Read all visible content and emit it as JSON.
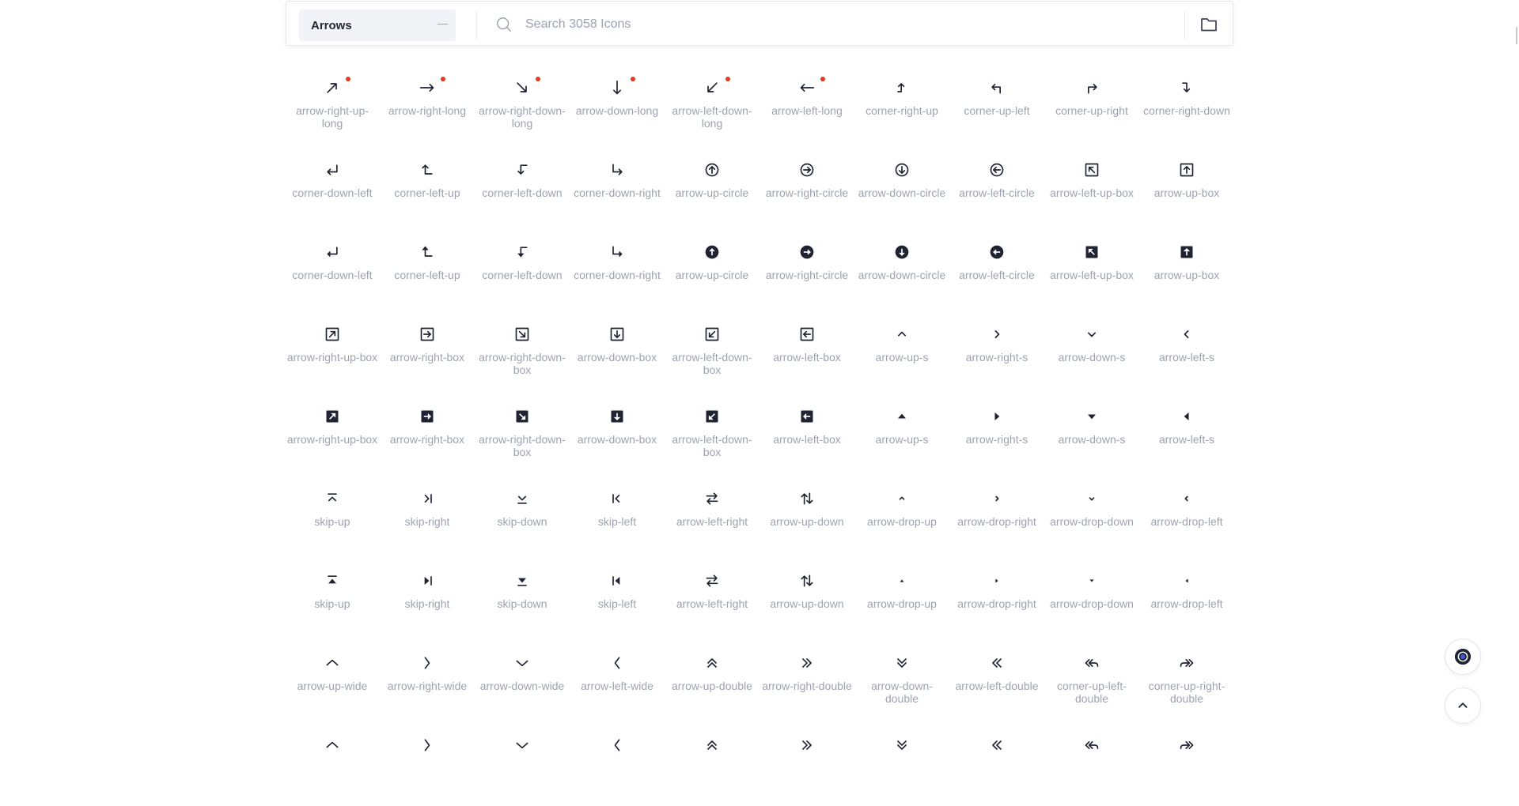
{
  "category_select": {
    "value": "Arrows"
  },
  "search": {
    "placeholder": "Search 3058 Icons"
  },
  "colors": {
    "icon": "#1e2432",
    "label": "#9ca3af",
    "new_dot": "#e03b1f"
  },
  "icons": [
    {
      "label": "arrow-right-up-long",
      "icon": "arrow-right-up-long",
      "new": true
    },
    {
      "label": "arrow-right-long",
      "icon": "arrow-right-long",
      "new": true
    },
    {
      "label": "arrow-right-down-long",
      "icon": "arrow-right-down-long",
      "new": true
    },
    {
      "label": "arrow-down-long",
      "icon": "arrow-down-long",
      "new": true
    },
    {
      "label": "arrow-left-down-long",
      "icon": "arrow-left-down-long",
      "new": true
    },
    {
      "label": "arrow-left-long",
      "icon": "arrow-left-long",
      "new": true
    },
    {
      "label": "corner-right-up",
      "icon": "corner-right-up"
    },
    {
      "label": "corner-up-left",
      "icon": "corner-up-left"
    },
    {
      "label": "corner-up-right",
      "icon": "corner-up-right"
    },
    {
      "label": "corner-right-down",
      "icon": "corner-right-down"
    },
    {
      "label": "corner-down-left",
      "icon": "corner-down-left"
    },
    {
      "label": "corner-left-up",
      "icon": "corner-left-up"
    },
    {
      "label": "corner-left-down",
      "icon": "corner-left-down"
    },
    {
      "label": "corner-down-right",
      "icon": "corner-down-right"
    },
    {
      "label": "arrow-up-circle",
      "icon": "arrow-up-circle"
    },
    {
      "label": "arrow-right-circle",
      "icon": "arrow-right-circle"
    },
    {
      "label": "arrow-down-circle",
      "icon": "arrow-down-circle"
    },
    {
      "label": "arrow-left-circle",
      "icon": "arrow-left-circle"
    },
    {
      "label": "arrow-left-up-box",
      "icon": "arrow-left-up-box"
    },
    {
      "label": "arrow-up-box",
      "icon": "arrow-up-box"
    },
    {
      "label": "corner-down-left",
      "icon": "corner-down-left-solid"
    },
    {
      "label": "corner-left-up",
      "icon": "corner-left-up-solid"
    },
    {
      "label": "corner-left-down",
      "icon": "corner-left-down-solid"
    },
    {
      "label": "corner-down-right",
      "icon": "corner-down-right-solid"
    },
    {
      "label": "arrow-up-circle",
      "icon": "arrow-up-circle-solid"
    },
    {
      "label": "arrow-right-circle",
      "icon": "arrow-right-circle-solid"
    },
    {
      "label": "arrow-down-circle",
      "icon": "arrow-down-circle-solid"
    },
    {
      "label": "arrow-left-circle",
      "icon": "arrow-left-circle-solid"
    },
    {
      "label": "arrow-left-up-box",
      "icon": "arrow-left-up-box-solid"
    },
    {
      "label": "arrow-up-box",
      "icon": "arrow-up-box-solid"
    },
    {
      "label": "arrow-right-up-box",
      "icon": "arrow-right-up-box"
    },
    {
      "label": "arrow-right-box",
      "icon": "arrow-right-box"
    },
    {
      "label": "arrow-right-down-box",
      "icon": "arrow-right-down-box"
    },
    {
      "label": "arrow-down-box",
      "icon": "arrow-down-box"
    },
    {
      "label": "arrow-left-down-box",
      "icon": "arrow-left-down-box"
    },
    {
      "label": "arrow-left-box",
      "icon": "arrow-left-box"
    },
    {
      "label": "arrow-up-s",
      "icon": "arrow-up-s"
    },
    {
      "label": "arrow-right-s",
      "icon": "arrow-right-s"
    },
    {
      "label": "arrow-down-s",
      "icon": "arrow-down-s"
    },
    {
      "label": "arrow-left-s",
      "icon": "arrow-left-s"
    },
    {
      "label": "arrow-right-up-box",
      "icon": "arrow-right-up-box-solid"
    },
    {
      "label": "arrow-right-box",
      "icon": "arrow-right-box-solid"
    },
    {
      "label": "arrow-right-down-box",
      "icon": "arrow-right-down-box-solid"
    },
    {
      "label": "arrow-down-box",
      "icon": "arrow-down-box-solid"
    },
    {
      "label": "arrow-left-down-box",
      "icon": "arrow-left-down-box-solid"
    },
    {
      "label": "arrow-left-box",
      "icon": "arrow-left-box-solid"
    },
    {
      "label": "arrow-up-s",
      "icon": "arrow-up-s-solid"
    },
    {
      "label": "arrow-right-s",
      "icon": "arrow-right-s-solid"
    },
    {
      "label": "arrow-down-s",
      "icon": "arrow-down-s-solid"
    },
    {
      "label": "arrow-left-s",
      "icon": "arrow-left-s-solid"
    },
    {
      "label": "skip-up",
      "icon": "skip-up"
    },
    {
      "label": "skip-right",
      "icon": "skip-right"
    },
    {
      "label": "skip-down",
      "icon": "skip-down"
    },
    {
      "label": "skip-left",
      "icon": "skip-left"
    },
    {
      "label": "arrow-left-right",
      "icon": "arrow-left-right"
    },
    {
      "label": "arrow-up-down",
      "icon": "arrow-up-down"
    },
    {
      "label": "arrow-drop-up",
      "icon": "arrow-drop-up"
    },
    {
      "label": "arrow-drop-right",
      "icon": "arrow-drop-right"
    },
    {
      "label": "arrow-drop-down",
      "icon": "arrow-drop-down"
    },
    {
      "label": "arrow-drop-left",
      "icon": "arrow-drop-left"
    },
    {
      "label": "skip-up",
      "icon": "skip-up-solid"
    },
    {
      "label": "skip-right",
      "icon": "skip-right-solid"
    },
    {
      "label": "skip-down",
      "icon": "skip-down-solid"
    },
    {
      "label": "skip-left",
      "icon": "skip-left-solid"
    },
    {
      "label": "arrow-left-right",
      "icon": "arrow-left-right-solid"
    },
    {
      "label": "arrow-up-down",
      "icon": "arrow-up-down-solid"
    },
    {
      "label": "arrow-drop-up",
      "icon": "arrow-drop-up-solid"
    },
    {
      "label": "arrow-drop-right",
      "icon": "arrow-drop-right-solid"
    },
    {
      "label": "arrow-drop-down",
      "icon": "arrow-drop-down-solid"
    },
    {
      "label": "arrow-drop-left",
      "icon": "arrow-drop-left-solid"
    },
    {
      "label": "arrow-up-wide",
      "icon": "arrow-up-wide"
    },
    {
      "label": "arrow-right-wide",
      "icon": "arrow-right-wide"
    },
    {
      "label": "arrow-down-wide",
      "icon": "arrow-down-wide"
    },
    {
      "label": "arrow-left-wide",
      "icon": "arrow-left-wide"
    },
    {
      "label": "arrow-up-double",
      "icon": "arrow-up-double"
    },
    {
      "label": "arrow-right-double",
      "icon": "arrow-right-double"
    },
    {
      "label": "arrow-down-double",
      "icon": "arrow-down-double"
    },
    {
      "label": "arrow-left-double",
      "icon": "arrow-left-double"
    },
    {
      "label": "corner-up-left-double",
      "icon": "corner-up-left-double"
    },
    {
      "label": "corner-up-right-double",
      "icon": "corner-up-right-double"
    },
    {
      "label": "",
      "icon": "arrow-up-wide-solid"
    },
    {
      "label": "",
      "icon": "arrow-right-wide-solid"
    },
    {
      "label": "",
      "icon": "arrow-down-wide-solid"
    },
    {
      "label": "",
      "icon": "arrow-left-wide-solid"
    },
    {
      "label": "",
      "icon": "arrow-up-double-solid"
    },
    {
      "label": "",
      "icon": "arrow-right-double-solid"
    },
    {
      "label": "",
      "icon": "arrow-down-double-solid"
    },
    {
      "label": "",
      "icon": "arrow-left-double-solid"
    },
    {
      "label": "",
      "icon": "corner-up-left-double-solid"
    },
    {
      "label": "",
      "icon": "corner-up-right-double-solid"
    }
  ]
}
